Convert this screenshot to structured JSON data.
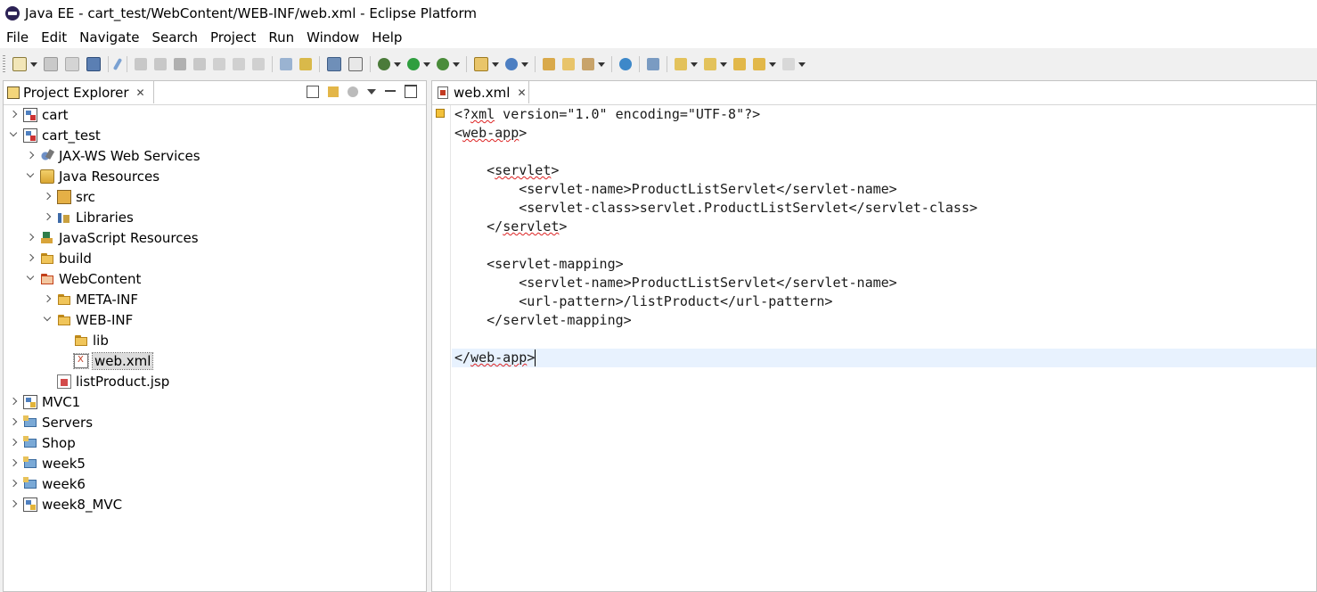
{
  "window": {
    "title": "Java EE - cart_test/WebContent/WEB-INF/web.xml - Eclipse Platform"
  },
  "menubar": [
    "File",
    "Edit",
    "Navigate",
    "Search",
    "Project",
    "Run",
    "Window",
    "Help"
  ],
  "explorer": {
    "tab_label": "Project Explorer",
    "tree": [
      {
        "label": "cart",
        "depth": 0,
        "state": "closed",
        "icon": "dynamic-web-project-icon"
      },
      {
        "label": "cart_test",
        "depth": 0,
        "state": "open",
        "icon": "dynamic-web-project-icon"
      },
      {
        "label": "JAX-WS Web Services",
        "depth": 1,
        "state": "closed",
        "icon": "web-services-icon"
      },
      {
        "label": "Java Resources",
        "depth": 1,
        "state": "open",
        "icon": "java-resources-icon"
      },
      {
        "label": "src",
        "depth": 2,
        "state": "closed",
        "icon": "source-folder-icon"
      },
      {
        "label": "Libraries",
        "depth": 2,
        "state": "closed",
        "icon": "libraries-icon"
      },
      {
        "label": "JavaScript Resources",
        "depth": 1,
        "state": "closed",
        "icon": "javascript-resources-icon"
      },
      {
        "label": "build",
        "depth": 1,
        "state": "closed",
        "icon": "folder-icon"
      },
      {
        "label": "WebContent",
        "depth": 1,
        "state": "open",
        "icon": "web-content-folder-icon"
      },
      {
        "label": "META-INF",
        "depth": 2,
        "state": "closed",
        "icon": "folder-icon"
      },
      {
        "label": "WEB-INF",
        "depth": 2,
        "state": "open",
        "icon": "folder-icon"
      },
      {
        "label": "lib",
        "depth": 3,
        "state": "none",
        "icon": "folder-icon"
      },
      {
        "label": "web.xml",
        "depth": 3,
        "state": "none",
        "icon": "xml-file-icon",
        "selected": true
      },
      {
        "label": "listProduct.jsp",
        "depth": 2,
        "state": "none",
        "icon": "jsp-file-icon"
      },
      {
        "label": "MVC1",
        "depth": 0,
        "state": "closed",
        "icon": "java-project-icon"
      },
      {
        "label": "Servers",
        "depth": 0,
        "state": "closed",
        "icon": "servers-project-icon"
      },
      {
        "label": "Shop",
        "depth": 0,
        "state": "closed",
        "icon": "servers-project-icon"
      },
      {
        "label": "week5",
        "depth": 0,
        "state": "closed",
        "icon": "servers-project-icon"
      },
      {
        "label": "week6",
        "depth": 0,
        "state": "closed",
        "icon": "servers-project-icon"
      },
      {
        "label": "week8_MVC",
        "depth": 0,
        "state": "closed",
        "icon": "java-project-icon"
      }
    ]
  },
  "editor": {
    "tab_label": "web.xml",
    "lines": [
      "<?xml version=\"1.0\" encoding=\"UTF-8\"?>",
      "<web-app>",
      "",
      "    <servlet>",
      "        <servlet-name>ProductListServlet</servlet-name>",
      "        <servlet-class>servlet.ProductListServlet</servlet-class>",
      "    </servlet>",
      "",
      "    <servlet-mapping>",
      "        <servlet-name>ProductListServlet</servlet-name>",
      "        <url-pattern>/listProduct</url-pattern>",
      "    </servlet-mapping>",
      "",
      "</web-app>"
    ],
    "current_line": 13
  }
}
